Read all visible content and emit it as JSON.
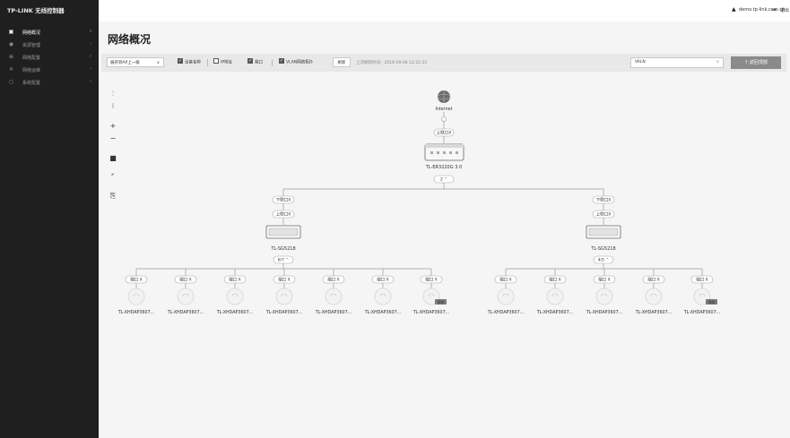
{
  "brand": "TP-LINK 无线控制器",
  "sidebar": {
    "items": [
      {
        "label": "网络概况",
        "icon": "monitor-icon",
        "glyph": "▣",
        "caret": "›",
        "active": true
      },
      {
        "label": "资源管理",
        "icon": "resource-icon",
        "glyph": "◉",
        "caret": "‹"
      },
      {
        "label": "网络配置",
        "icon": "globe-icon",
        "glyph": "⊕",
        "caret": "‹"
      },
      {
        "label": "网络运维",
        "icon": "tools-icon",
        "glyph": "✕",
        "caret": "‹"
      },
      {
        "label": "系统配置",
        "icon": "circle-icon",
        "glyph": "○",
        "caret": "‹"
      }
    ]
  },
  "header": {
    "user_email": "demo.tp-link.com.cn",
    "logout": "退出"
  },
  "page": {
    "title": "网络概况"
  },
  "toolbar": {
    "expand_ap_label": "展开到AP上一级",
    "expand_caret": "∨",
    "device_name": "设备名称",
    "ip_address": "IP地址",
    "port": "端口",
    "vlan_topology": "VLAN网络拓扑",
    "refresh": "刷新",
    "last_refresh": "上次刷新时间：2018-09-08 12:22:22",
    "vlan_value": "VALN",
    "vlan_caret": "∨",
    "back_top": "↑ 返回顶部",
    "checks": {
      "device_name": true,
      "ip_address": false,
      "port": true,
      "vlan_topology": true
    }
  },
  "tools": [
    "fit-icon",
    "tree-icon",
    "zoom-in-icon",
    "zoom-out-icon",
    "camera-icon",
    "fullscreen-icon",
    "export-icon"
  ],
  "tool_glyphs": [
    "⫶",
    "⁝",
    "+",
    "−",
    "■",
    "⌜",
    "⎘"
  ],
  "topology": {
    "internet_label": "Internet",
    "router": {
      "up_port": "上联口X",
      "name": "TL-ER3220G 3.0",
      "count": "2 ⌃"
    },
    "switches": [
      {
        "down_port": "下联口X",
        "up_port": "上联口X",
        "name": "TL-SG5218",
        "count": "6/7 ⌃",
        "aps": [
          {
            "port": "端口 X",
            "name": "TL-XHDAP3607..."
          },
          {
            "port": "端口 X",
            "name": "TL-XHDAP3607..."
          },
          {
            "port": "端口 X",
            "name": "TL-XHDAP3607..."
          },
          {
            "port": "端口 X",
            "name": "TL-XHDAP3607..."
          },
          {
            "port": "端口 X",
            "name": "TL-XHDAP3607..."
          },
          {
            "port": "端口 X",
            "name": "TL-XHDAP3607..."
          },
          {
            "port": "端口 X",
            "name": "TL-XHDAP3607...",
            "badge": "离线"
          }
        ]
      },
      {
        "down_port": "下联口X",
        "up_port": "上联口X",
        "name": "TL-SG5218",
        "count": "4/5 ⌃",
        "aps": [
          {
            "port": "端口 X",
            "name": "TL-XHDAP3607..."
          },
          {
            "port": "端口 X",
            "name": "TL-XHDAP3607..."
          },
          {
            "port": "端口 X",
            "name": "TL-XHDAP3607..."
          },
          {
            "port": "端口 X",
            "name": "TL-XHDAP3607..."
          },
          {
            "port": "端口 X",
            "name": "TL-XHDAP3607...",
            "badge": "离线"
          }
        ]
      }
    ]
  }
}
